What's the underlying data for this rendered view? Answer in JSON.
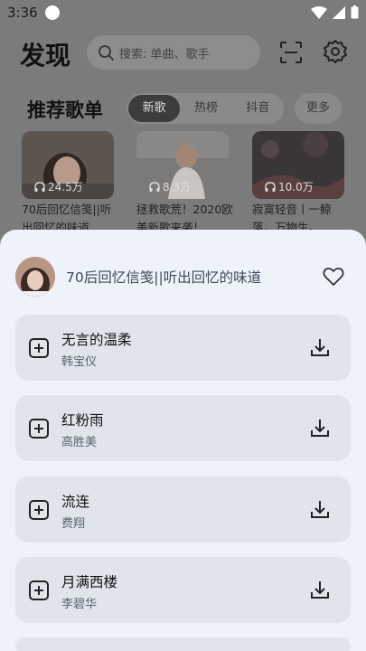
{
  "status": {
    "time": "3:36"
  },
  "header": {
    "title": "发现",
    "search_placeholder": "搜索: 单曲、歌手"
  },
  "section": {
    "title": "推荐歌单",
    "tabs": [
      {
        "label": "新歌"
      },
      {
        "label": "热榜"
      },
      {
        "label": "抖音"
      }
    ],
    "more_label": "更多"
  },
  "playlists": [
    {
      "title": "70后回忆信笺||听出回忆的味道",
      "plays": "24.5万"
    },
    {
      "title": "拯救歌荒！2020欧美新歌来袭！",
      "plays": "8.3万"
    },
    {
      "title": "寂寞轻音丨一鲸落，万物生。",
      "plays": "10.0万"
    }
  ],
  "sheet": {
    "title": "70后回忆信笺||听出回忆的味道",
    "songs": [
      {
        "name": "无言的温柔",
        "artist": "韩宝仪"
      },
      {
        "name": "红粉雨",
        "artist": "高胜美"
      },
      {
        "name": "流连",
        "artist": "费翔"
      },
      {
        "name": "月满西楼",
        "artist": "李碧华"
      }
    ]
  },
  "colors": {
    "sheet_bg": "#eef3f9",
    "song_card_bg": "#e0e5ec",
    "scrim": "#7b7b7b"
  }
}
